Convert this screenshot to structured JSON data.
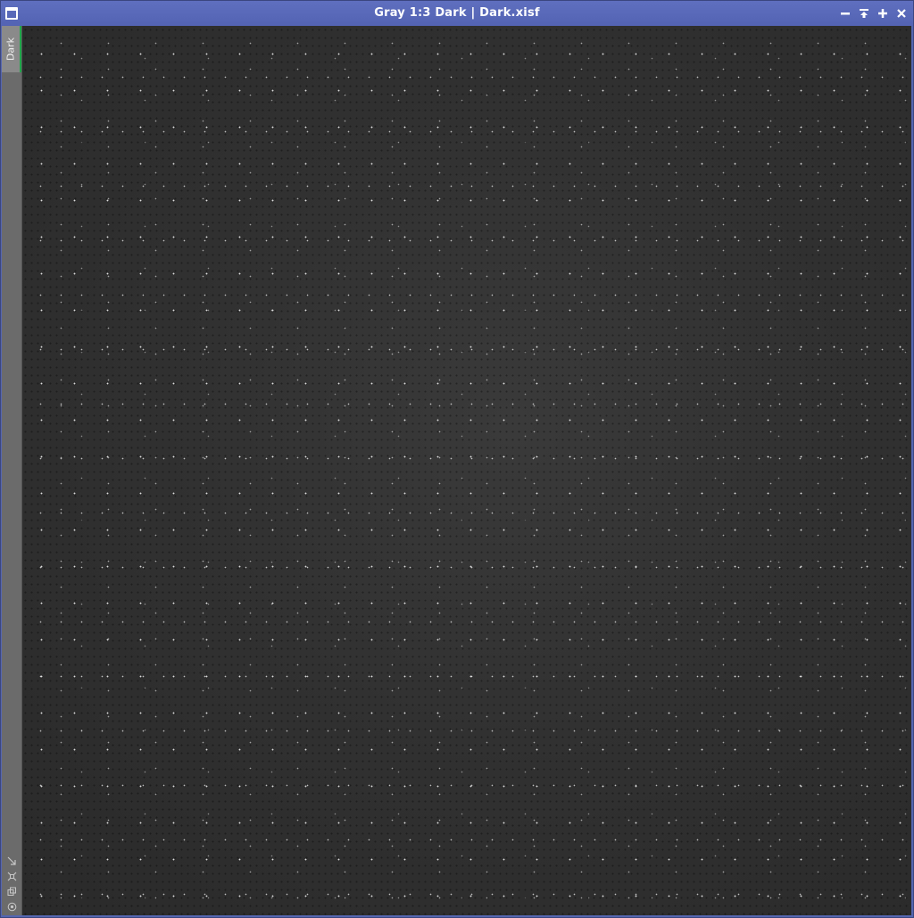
{
  "window": {
    "title": "Gray 1:3 Dark | Dark.xisf",
    "controls": {
      "minimize": "minimize-icon",
      "shade": "shade-icon",
      "maximize": "maximize-icon",
      "close": "close-icon"
    }
  },
  "sidebar": {
    "tab_label": "Dark",
    "tools": [
      "resize-icon",
      "fit-view-icon",
      "clone-icon",
      "settings-icon"
    ]
  },
  "colors": {
    "titlebar": "#5566b0",
    "active_tab_accent": "#1fa84a",
    "image_background": "#2e2e2e"
  }
}
